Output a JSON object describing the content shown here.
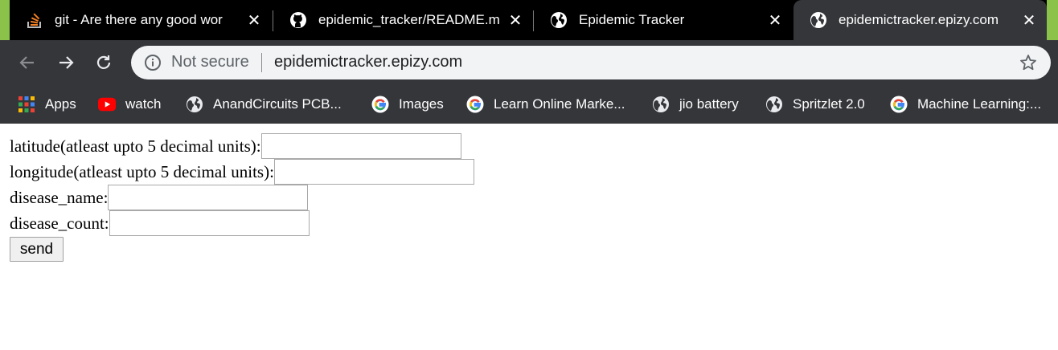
{
  "tabs": [
    {
      "title": "git - Are there any good wor",
      "icon": "stackoverflow-icon",
      "active": false
    },
    {
      "title": "epidemic_tracker/README.m",
      "icon": "github-icon",
      "active": false
    },
    {
      "title": "Epidemic Tracker",
      "icon": "globe-icon",
      "active": false
    },
    {
      "title": "epidemictracker.epizy.com",
      "icon": "globe-icon",
      "active": true
    }
  ],
  "toolbar": {
    "security_label": "Not secure",
    "url": "epidemictracker.epizy.com"
  },
  "bookmarks": [
    {
      "label": "Apps",
      "icon": "apps-grid-icon"
    },
    {
      "label": "watch",
      "icon": "youtube-icon"
    },
    {
      "label": "AnandCircuits PCB...",
      "icon": "globe-icon"
    },
    {
      "label": "Images",
      "icon": "google-icon"
    },
    {
      "label": "Learn Online Marke...",
      "icon": "google-icon"
    },
    {
      "label": "jio battery",
      "icon": "globe-icon"
    },
    {
      "label": "Spritzlet 2.0",
      "icon": "globe-icon"
    },
    {
      "label": "Machine Learning:...",
      "icon": "google-icon"
    }
  ],
  "form": {
    "latitude_label": "latitude(atleast upto 5 decimal units):",
    "longitude_label": "longitude(atleast upto 5 decimal units):",
    "disease_name_label": "disease_name:",
    "disease_count_label": "disease_count:",
    "latitude_value": "",
    "longitude_value": "",
    "disease_name_value": "",
    "disease_count_value": "",
    "send_label": "send"
  },
  "colors": {
    "tab_strip": "#000000",
    "active_tab": "#35363a",
    "toolbar": "#35363a",
    "omnibox": "#f1f3f4",
    "accent_green": "#8bc34a"
  }
}
